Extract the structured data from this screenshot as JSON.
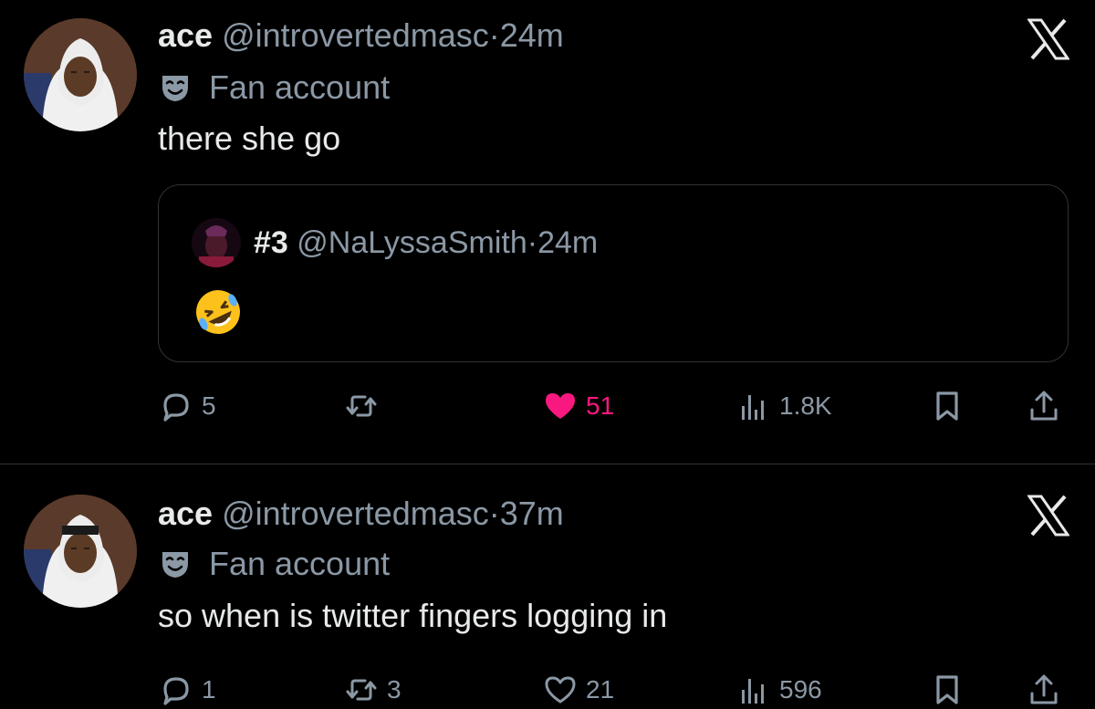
{
  "colors": {
    "background": "#000000",
    "text": "#e7e9ea",
    "muted": "#8b98a5",
    "like": "#f91880",
    "border": "#2f3336"
  },
  "tweets": [
    {
      "name": "ace",
      "handle": "@introvertedmasc",
      "dot": "·",
      "time": "24m",
      "label_icon": "theater-mask-icon",
      "label": "Fan account",
      "text": "there she go",
      "quote": {
        "name": "#3",
        "handle": "@NaLyssaSmith",
        "dot": "·",
        "time": "24m",
        "emoji": "rolling-on-floor-laughing-emoji"
      },
      "actions": {
        "replies": "5",
        "reposts": "",
        "likes": "51",
        "liked": true,
        "views": "1.8K"
      }
    },
    {
      "name": "ace",
      "handle": "@introvertedmasc",
      "dot": "·",
      "time": "37m",
      "label_icon": "theater-mask-icon",
      "label": "Fan account",
      "text": "so when is twitter fingers logging in",
      "actions": {
        "replies": "1",
        "reposts": "3",
        "likes": "21",
        "liked": false,
        "views": "596"
      }
    }
  ]
}
